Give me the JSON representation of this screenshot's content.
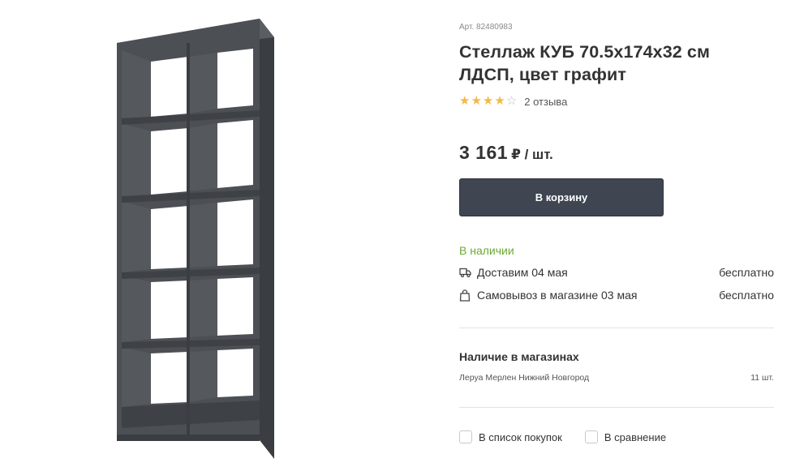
{
  "product": {
    "sku": "Арт. 82480983",
    "title": "Стеллаж КУБ 70.5x174x32 см ЛДСП, цвет графит",
    "rating": 4,
    "rating_max": 5,
    "reviews_label": "2 отзыва",
    "price": "3 161",
    "price_unit": "₽ / шт.",
    "image_icon": "shelving-unit-image"
  },
  "actions": {
    "add_to_cart_label": "В корзину"
  },
  "availability": {
    "status": "В наличии",
    "delivery": [
      {
        "icon": "truck-icon",
        "label": "Доставим 04 мая",
        "cost": "бесплатно"
      },
      {
        "icon": "shopping-bag-icon",
        "label": "Самовывоз в магазине 03 мая",
        "cost": "бесплатно"
      }
    ]
  },
  "stores": {
    "title": "Наличие в магазинах",
    "items": [
      {
        "name": "Леруа Мерлен Нижний Новгород",
        "quantity": "11 шт."
      }
    ]
  },
  "options": {
    "shopping_list_label": "В список покупок",
    "compare_label": "В сравнение"
  },
  "colors": {
    "accent_button": "#3f4651",
    "stock_green": "#6aab32",
    "star": "#f5b945"
  }
}
